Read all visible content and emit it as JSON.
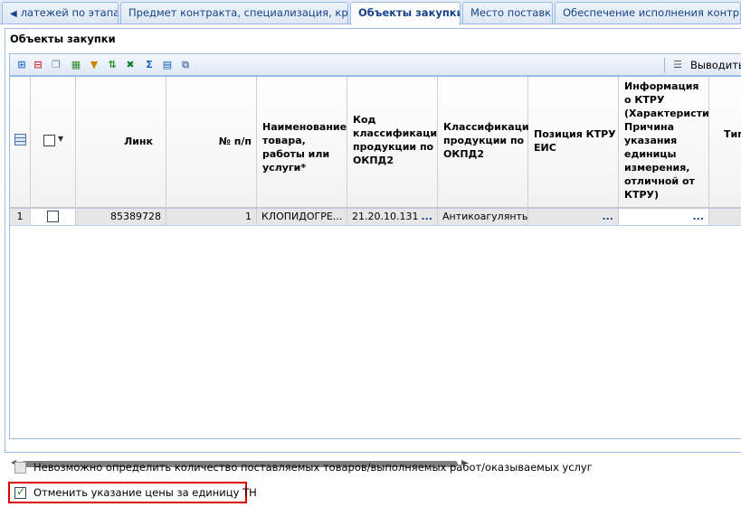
{
  "tabs": [
    {
      "label": "латежей по этапам",
      "active": false
    },
    {
      "label": "Предмет контракта, специализация, критерии",
      "active": false
    },
    {
      "label": "Объекты закупки",
      "active": true
    },
    {
      "label": "Место поставки",
      "active": false
    },
    {
      "label": "Обеспечение исполнения контракта",
      "active": false
    }
  ],
  "panel": {
    "title": "Объекты закупки"
  },
  "toolbar": {
    "icons": [
      "add-row-icon",
      "remove-row-icon",
      "copy-icon",
      "import-icon",
      "filter-icon",
      "sort-icon",
      "excel-icon",
      "sum-icon",
      "columns-icon",
      "duplicate-icon"
    ],
    "output_label": "Выводить г"
  },
  "grid": {
    "columns": [
      {
        "key": "link",
        "label": "Линк"
      },
      {
        "key": "num",
        "label": "№ п/п"
      },
      {
        "key": "name",
        "label": "Наименование товара, работы или услуги*"
      },
      {
        "key": "okpd_code",
        "label": "Код классификации продукции по ОКПД2"
      },
      {
        "key": "okpd_class",
        "label": "Классификация продукции по ОКПД2"
      },
      {
        "key": "ktru_pos",
        "label": "Позиция КТРУ ЕИС"
      },
      {
        "key": "ktru_info",
        "label": "Информация о КТРУ (Характеристи… Причина указания единицы измерения, отличной от КТРУ)"
      },
      {
        "key": "type",
        "label": "Тип"
      }
    ],
    "rows": [
      {
        "row_num": "1",
        "link": "85389728",
        "num": "1",
        "name": "КЛОПИДОГРЕ...",
        "okpd_code": "21.20.10.131",
        "okpd_class": "Антикоагулянты",
        "ktru_pos": "",
        "ktru_info": ""
      }
    ],
    "dots": "..."
  },
  "options": {
    "cannot_determine_qty": {
      "label": "Невозможно определить количество поставляемых товаров/выполняемых работ/оказываемых услуг",
      "checked": false
    },
    "cancel_unit_price": {
      "label": "Отменить указание цены за единицу ТН",
      "checked": true
    }
  }
}
